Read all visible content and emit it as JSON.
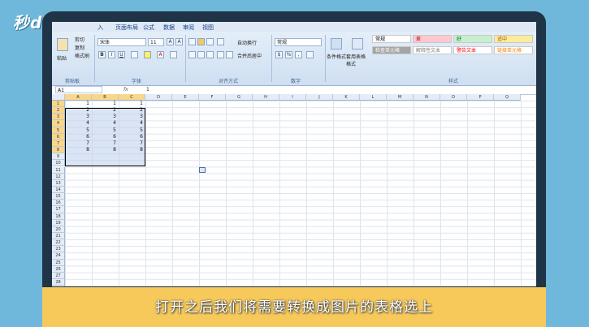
{
  "overlay": {
    "logo": "秒dong视频",
    "subtitle": "打开之后我们将需要转换成图片的表格选上"
  },
  "ribbon": {
    "tabs": [
      "入",
      "页面布局",
      "公式",
      "数据",
      "审阅",
      "视图"
    ],
    "clipboard": {
      "paste": "粘贴",
      "cut": "剪切",
      "copy": "复制",
      "format_painter": "格式刷",
      "group": "剪贴板"
    },
    "font": {
      "name": "宋体",
      "size": "11",
      "group": "字体",
      "bold": "B",
      "italic": "I",
      "underline": "U"
    },
    "alignment": {
      "wrap": "自动换行",
      "merge": "合并后居中",
      "group": "对齐方式"
    },
    "number": {
      "format": "常规",
      "group": "数字"
    },
    "styles": {
      "conditional": "条件格式",
      "table_format": "套用表格格式",
      "cells": [
        {
          "label": "常规",
          "bg": "#ffffff",
          "color": "#000000"
        },
        {
          "label": "差",
          "bg": "#ffc7ce",
          "color": "#9c0006"
        },
        {
          "label": "好",
          "bg": "#c6efce",
          "color": "#006100"
        },
        {
          "label": "适中",
          "bg": "#ffeb9c",
          "color": "#9c5700"
        },
        {
          "label": "检查单元格",
          "bg": "#a5a5a5",
          "color": "#ffffff"
        },
        {
          "label": "解释性文本",
          "bg": "#ffffff",
          "color": "#7f7f7f"
        },
        {
          "label": "警告文本",
          "bg": "#ffffff",
          "color": "#ff0000"
        },
        {
          "label": "链接单元格",
          "bg": "#ffffff",
          "color": "#fa7d00"
        }
      ],
      "group": "样式"
    }
  },
  "formula_bar": {
    "name_box": "A1",
    "fx": "fx",
    "value": "1"
  },
  "sheet": {
    "columns": [
      "A",
      "B",
      "C",
      "D",
      "E",
      "F",
      "G",
      "H",
      "I",
      "J",
      "K",
      "L",
      "M",
      "N",
      "O",
      "P",
      "Q"
    ],
    "rows": [
      "1",
      "2",
      "3",
      "4",
      "5",
      "6",
      "7",
      "8",
      "9",
      "10",
      "11",
      "12",
      "13",
      "14",
      "15",
      "16",
      "17",
      "18",
      "19",
      "20",
      "21",
      "22",
      "23",
      "24",
      "25",
      "26",
      "27",
      "28",
      "29"
    ],
    "data": [
      [
        "1",
        "1",
        "1"
      ],
      [
        "2",
        "2",
        "2"
      ],
      [
        "3",
        "3",
        "3"
      ],
      [
        "4",
        "4",
        "4"
      ],
      [
        "5",
        "5",
        "5"
      ],
      [
        "6",
        "6",
        "6"
      ],
      [
        "7",
        "7",
        "7"
      ],
      [
        "8",
        "8",
        "8"
      ]
    ]
  }
}
